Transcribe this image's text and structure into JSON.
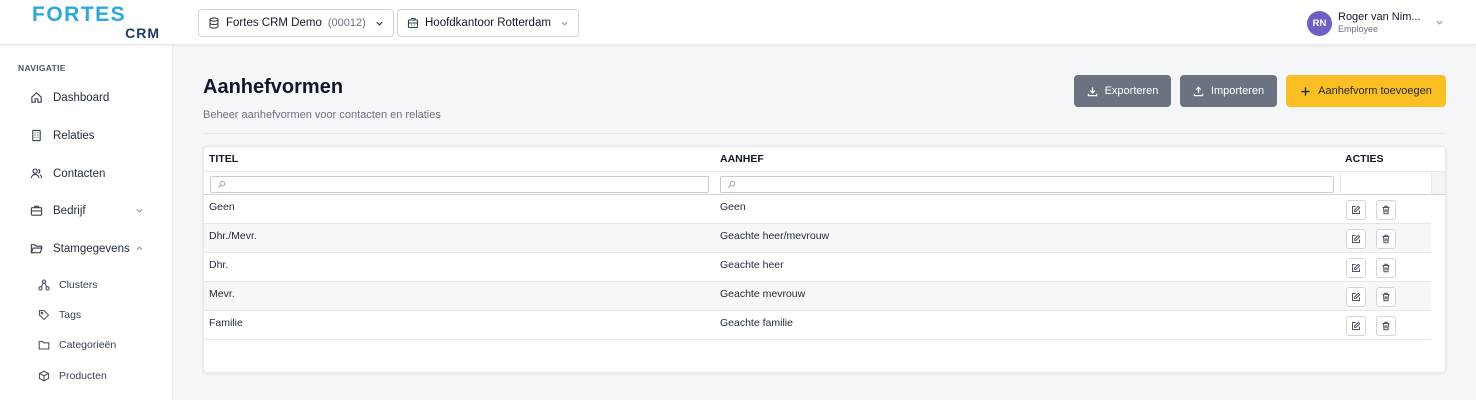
{
  "header": {
    "logo_line1": "FORTES",
    "logo_line2": "CRM",
    "company": {
      "name": "Fortes CRM Demo",
      "code": "(00012)"
    },
    "location": {
      "name": "Hoofdkantoor Rotterdam"
    },
    "user": {
      "initials": "RN",
      "name": "Roger van Nim...",
      "role": "Employee",
      "avatar_color": "#6d5fc6"
    }
  },
  "sidebar": {
    "heading": "NAVIGATIE",
    "items": [
      {
        "label": "Dashboard",
        "icon": "home-icon"
      },
      {
        "label": "Relaties",
        "icon": "building-icon"
      },
      {
        "label": "Contacten",
        "icon": "users-icon"
      },
      {
        "label": "Bedrijf",
        "icon": "briefcase-icon",
        "expandable": true,
        "expanded": false
      },
      {
        "label": "Stamgegevens",
        "icon": "folder-open-icon",
        "expandable": true,
        "expanded": true
      }
    ],
    "subitems": [
      {
        "label": "Clusters",
        "icon": "cluster-icon"
      },
      {
        "label": "Tags",
        "icon": "tag-icon"
      },
      {
        "label": "Categorieën",
        "icon": "folder-icon"
      },
      {
        "label": "Producten",
        "icon": "box-icon"
      }
    ]
  },
  "page": {
    "title": "Aanhefvormen",
    "subtitle": "Beheer aanhefvormen voor contacten en relaties",
    "buttons": {
      "export": "Exporteren",
      "import": "Importeren",
      "add": "Aanhefvorm toevoegen"
    }
  },
  "table": {
    "columns": [
      "TITEL",
      "AANHEF",
      "ACTIES"
    ],
    "rows": [
      {
        "titel": "Geen",
        "aanhef": "Geen"
      },
      {
        "titel": "Dhr./Mevr.",
        "aanhef": "Geachte heer/mevrouw"
      },
      {
        "titel": "Dhr.",
        "aanhef": "Geachte heer"
      },
      {
        "titel": "Mevr.",
        "aanhef": "Geachte mevrouw"
      },
      {
        "titel": "Familie",
        "aanhef": "Geachte familie"
      }
    ]
  },
  "colors": {
    "accent": "#fbbf24",
    "secondary_button": "#6b7380",
    "logo_primary": "#2aa8e0",
    "logo_secondary": "#1e3a5f"
  }
}
